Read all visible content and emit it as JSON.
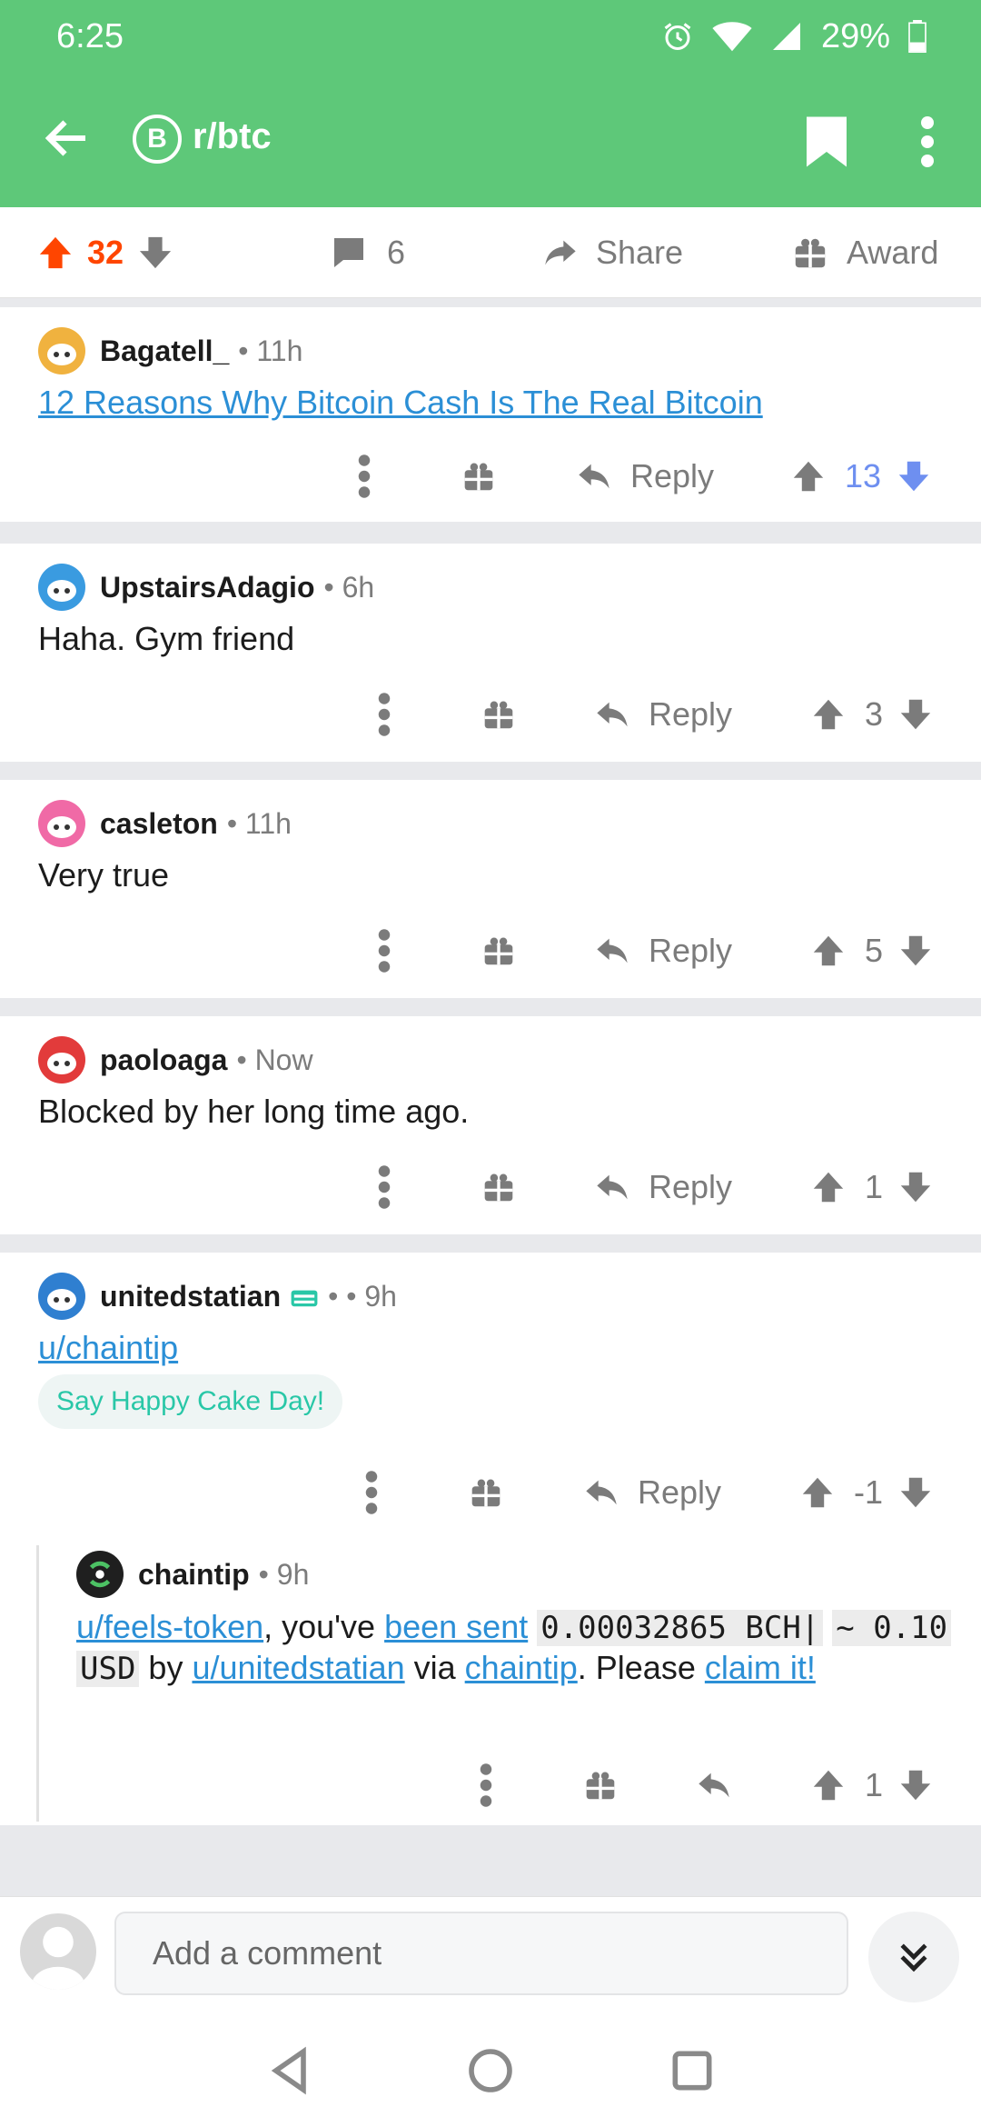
{
  "status": {
    "time": "6:25",
    "battery": "29%"
  },
  "header": {
    "subreddit": "r/btc",
    "sub_icon_glyph": "B",
    "color": "#5ec879"
  },
  "postbar": {
    "score": "32",
    "comments": "6",
    "share": "Share",
    "award": "Award"
  },
  "comments": [
    {
      "author": "Bagatell_",
      "time": "11h",
      "body_link": "12 Reasons Why Bitcoin Cash Is The Real Bitcoin",
      "score": "13",
      "reply": "Reply",
      "avatar_color": "#f0b23f"
    },
    {
      "author": "UpstairsAdagio",
      "time": "6h",
      "body": "Haha. Gym friend",
      "score": "3",
      "reply": "Reply",
      "avatar_color": "#3a9be0"
    },
    {
      "author": "casleton",
      "time": "11h",
      "body": "Very true",
      "score": "5",
      "reply": "Reply",
      "avatar_color": "#f06aa6"
    },
    {
      "author": "paoloaga",
      "time": "Now",
      "body": "Blocked by her long time ago.",
      "score": "1",
      "reply": "Reply",
      "avatar_color": "#e23b3b"
    },
    {
      "author": "unitedstatian",
      "time": "9h",
      "body_link": "u/chaintip",
      "cake": "Say Happy Cake Day!",
      "score": "-1",
      "reply": "Reply",
      "avatar_color": "#2f7fd0"
    }
  ],
  "nested": {
    "author": "chaintip",
    "time": "9h",
    "score": "1",
    "text": {
      "link1": "u/feels-token",
      "t1": ", you've ",
      "link2": "been sent",
      "code1": "0.00032865 BCH|",
      "code2": "~ 0.10",
      "code3": "USD",
      "t2": " by ",
      "link3": "u/unitedstatian",
      "t3": " via ",
      "link4": "chaintip",
      "t4": ". Please ",
      "link5": "claim it!"
    }
  },
  "composer": {
    "placeholder": "Add a comment"
  }
}
